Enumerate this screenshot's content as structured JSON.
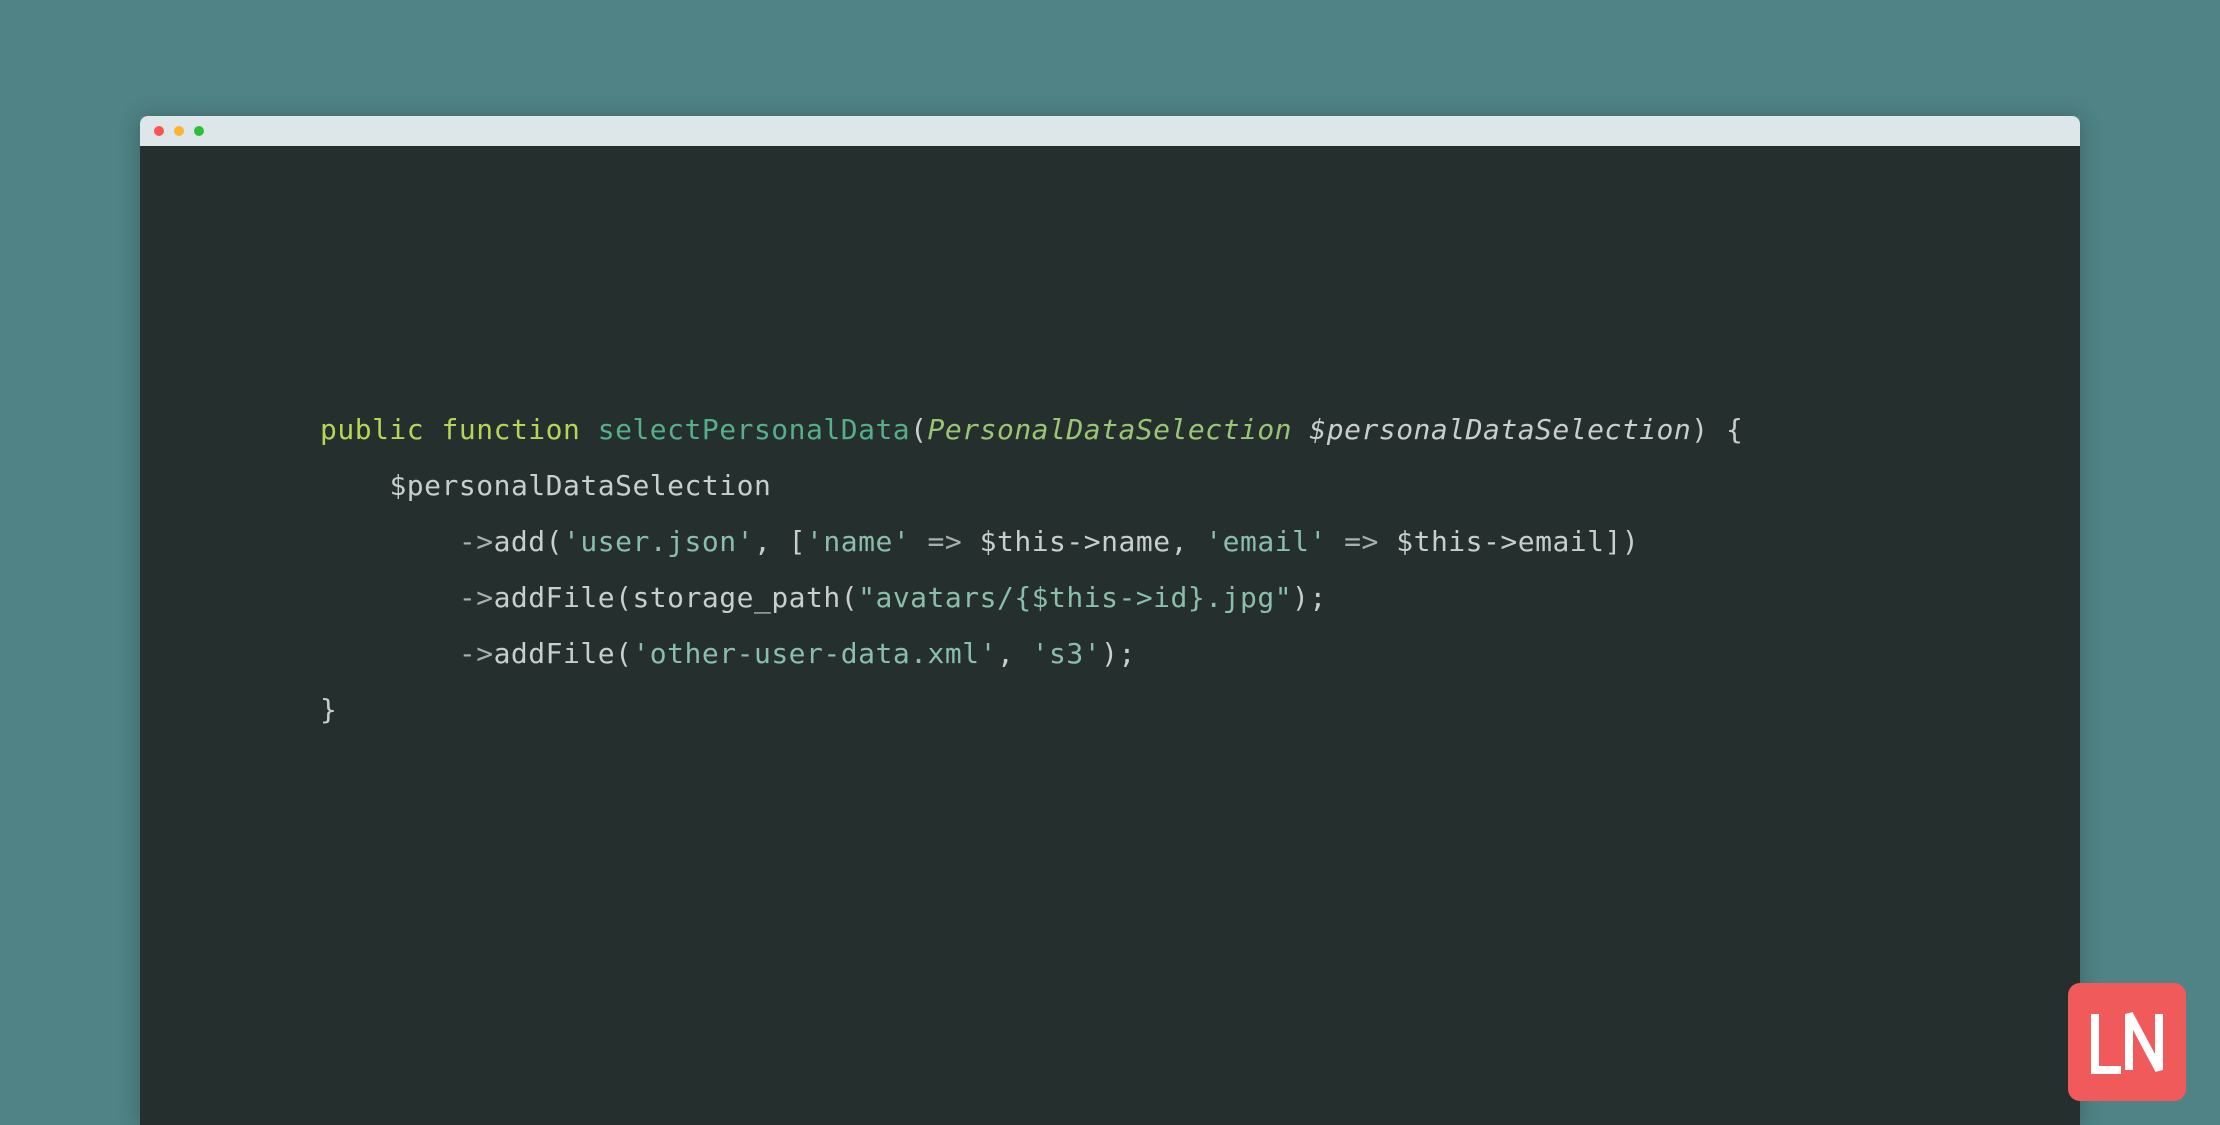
{
  "window_controls": {
    "close_color": "#fe544f",
    "minimize_color": "#fab42f",
    "maximize_color": "#2bc038"
  },
  "code": {
    "kw_public": "public",
    "kw_function": "function",
    "fn_name": "selectPersonalData",
    "param_type": "PersonalDataSelection",
    "param_var": "$personalDataSelection",
    "open_brace": " {",
    "line2_var": "$personalDataSelection",
    "line3_method": "add",
    "line3_str1": "'user.json'",
    "line3_key1": "'name'",
    "line3_val1": "$this->name",
    "line3_key2": "'email'",
    "line3_val2": "$this->email",
    "line4_method": "addFile",
    "line4_call": "storage_path",
    "line4_str": "\"avatars/{$this->id}.jpg\"",
    "line5_method": "addFile",
    "line5_str1": "'other-user-data.xml'",
    "line5_str2": "'s3'",
    "close_brace": "}"
  },
  "logo_text": "LN"
}
